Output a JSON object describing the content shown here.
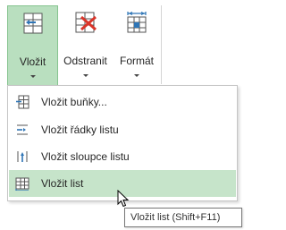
{
  "ribbon": {
    "buttons": [
      {
        "label": "Vložit",
        "icon": "insert-cells-icon",
        "active": true
      },
      {
        "label": "Odstranit",
        "icon": "delete-cells-icon",
        "active": false
      },
      {
        "label": "Formát",
        "icon": "format-cells-icon",
        "active": false
      }
    ]
  },
  "menu": {
    "items": [
      {
        "label": "Vložit buňky...",
        "icon": "insert-cells-icon",
        "highlighted": false
      },
      {
        "label": "Vložit řádky listu",
        "icon": "insert-rows-icon",
        "highlighted": false
      },
      {
        "label": "Vložit sloupce listu",
        "icon": "insert-columns-icon",
        "highlighted": false
      },
      {
        "label": "Vložit list",
        "icon": "insert-sheet-icon",
        "highlighted": true
      }
    ]
  },
  "tooltip": {
    "text": "Vložit list (Shift+F11)"
  },
  "colors": {
    "active_fill": "#b9dfbf",
    "highlight_fill": "#c6e4ca",
    "accent_red": "#d9352a",
    "accent_blue": "#2e75b6"
  }
}
